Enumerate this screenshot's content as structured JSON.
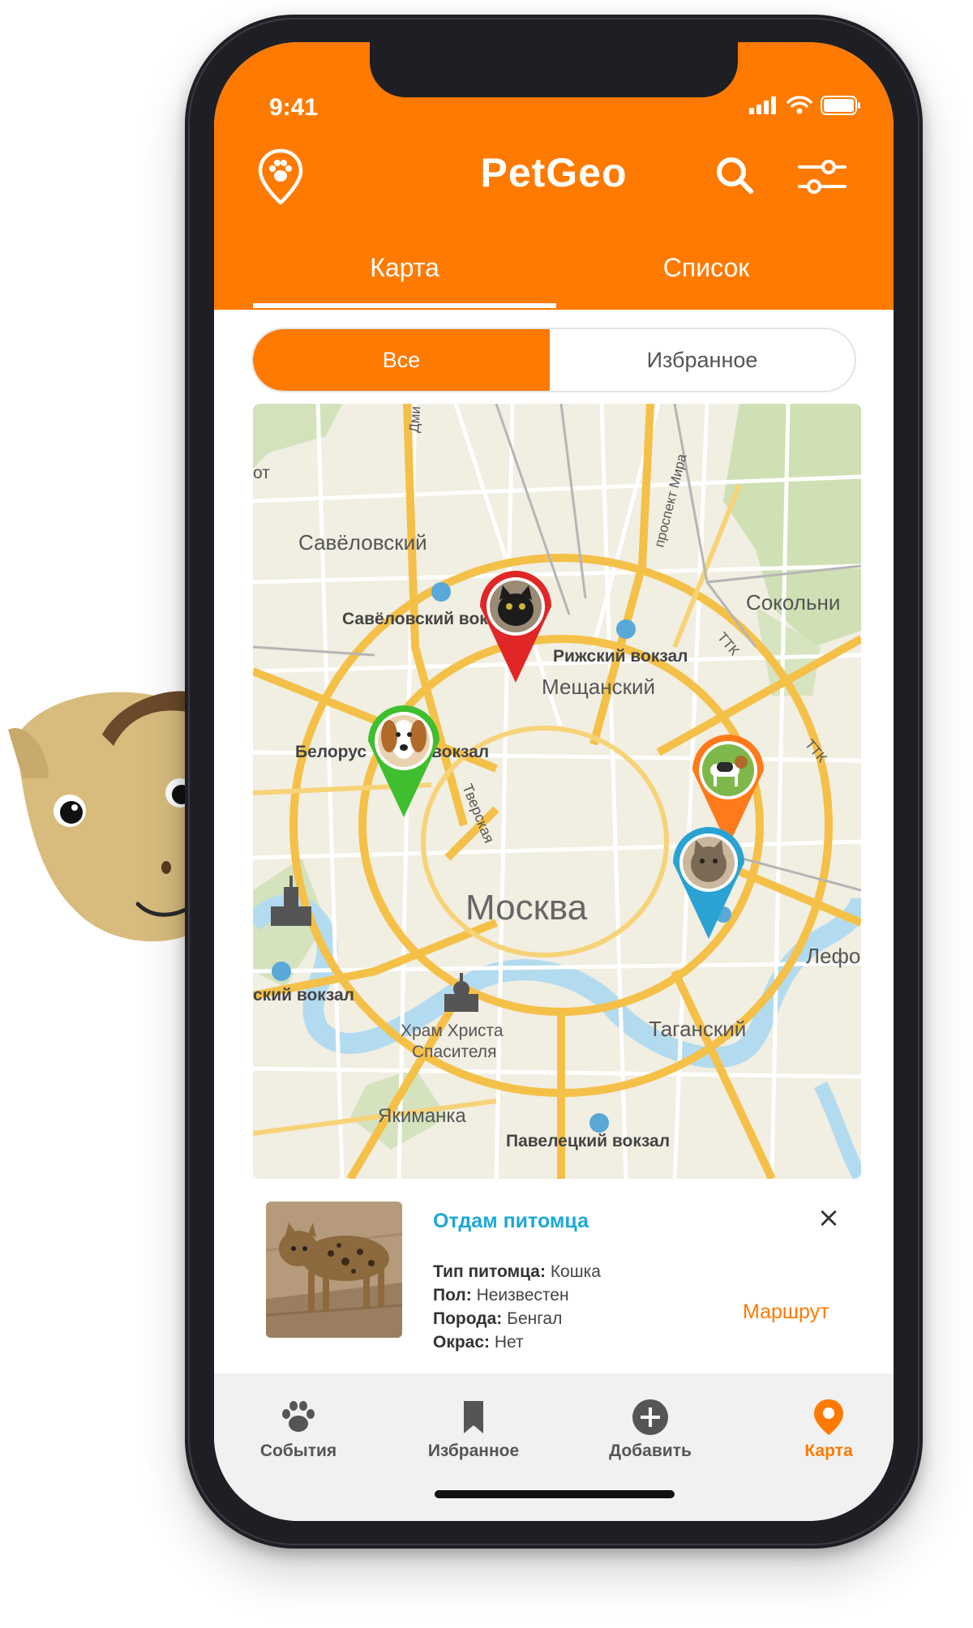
{
  "status_bar": {
    "time": "9:41"
  },
  "app": {
    "title": "PetGeo",
    "brand_color": "#ff7a00"
  },
  "header": {
    "location_icon": "paw-location-icon",
    "search_icon": "search-icon",
    "filter_icon": "filter-sliders-icon"
  },
  "tabs": [
    {
      "label": "Карта",
      "active": true
    },
    {
      "label": "Список",
      "active": false
    }
  ],
  "segment": {
    "all_label": "Все",
    "favorites_label": "Избранное",
    "selected": "Все"
  },
  "map": {
    "labels": {
      "savelovsky": "Савёловский",
      "savelovsky_station": "Савёловский вокзал",
      "rizhsky_station": "Рижский вокзал",
      "meshchansky": "Мещанский",
      "belorussky_a": "Белорус",
      "belorussky_b": "вокзал",
      "tverskaya": "Тверская",
      "moscow": "Москва",
      "sokolniki": "Сокольни",
      "lefortovo": "Лефо",
      "kiyevsky": "ский вокзал",
      "cathedral_1": "Храм Христа",
      "cathedral_2": "Спасителя",
      "tagansky": "Таганский",
      "yakimanka": "Якиманка",
      "paveletsky": "Павелецкий вокзал",
      "prospekt_mira": "проспект Мира",
      "ttk_1": "ТТК",
      "ttk_2": "ТТК",
      "dm": "Дми",
      "ot": "от"
    },
    "pins": [
      {
        "name": "pin-dog-green",
        "color": "#3fbf2f",
        "pet": "dog"
      },
      {
        "name": "pin-cat-red",
        "color": "#e02626",
        "pet": "cat"
      },
      {
        "name": "pin-dog-orange",
        "color": "#ff7a1a",
        "pet": "dog"
      },
      {
        "name": "pin-cat-blue",
        "color": "#2aa3d2",
        "pet": "cat"
      }
    ]
  },
  "card": {
    "title": "Отдам питомца",
    "close": "×",
    "fields": [
      {
        "label": "Тип питомца:",
        "value": "Кошка"
      },
      {
        "label": "Пол:",
        "value": "Неизвестен"
      },
      {
        "label": "Порода:",
        "value": "Бенгал"
      },
      {
        "label": "Окрас:",
        "value": "Нет"
      }
    ],
    "route_label": "Маршрут"
  },
  "bottom_nav": [
    {
      "label": "События",
      "icon": "paw-icon",
      "active": false
    },
    {
      "label": "Избранное",
      "icon": "bookmark-icon",
      "active": false
    },
    {
      "label": "Добавить",
      "icon": "plus-circle-icon",
      "active": false
    },
    {
      "label": "Карта",
      "icon": "map-pin-icon",
      "active": true
    }
  ]
}
